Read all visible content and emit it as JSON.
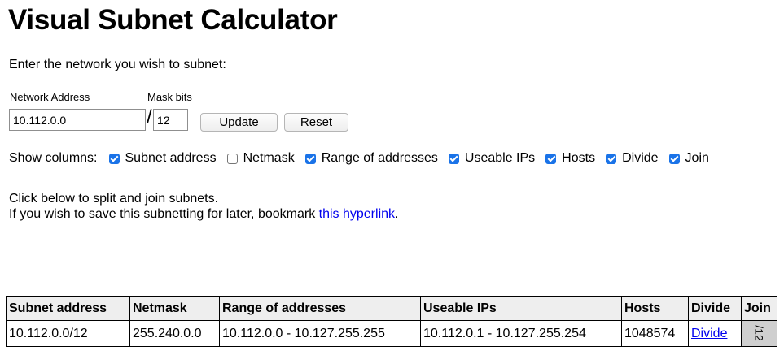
{
  "page": {
    "title": "Visual Subnet Calculator",
    "intro": "Enter the network you wish to subnet:"
  },
  "form": {
    "network_label": "Network Address",
    "network_value": "10.112.0.0",
    "mask_label": "Mask bits",
    "slash": "/",
    "mask_value": "12",
    "update_label": "Update",
    "reset_label": "Reset"
  },
  "columns": {
    "label": "Show columns:",
    "options": [
      {
        "label": "Subnet address",
        "checked": true
      },
      {
        "label": "Netmask",
        "checked": false
      },
      {
        "label": "Range of addresses",
        "checked": true
      },
      {
        "label": "Useable IPs",
        "checked": true
      },
      {
        "label": "Hosts",
        "checked": true
      },
      {
        "label": "Divide",
        "checked": true
      },
      {
        "label": "Join",
        "checked": true
      }
    ]
  },
  "help": {
    "line1": "Click below to split and join subnets.",
    "line2_prefix": "If you wish to save this subnetting for later, bookmark ",
    "link_text": "this hyperlink",
    "line2_suffix": "."
  },
  "table": {
    "headers": [
      "Subnet address",
      "Netmask",
      "Range of addresses",
      "Useable IPs",
      "Hosts",
      "Divide",
      "Join"
    ],
    "rows": [
      {
        "subnet": "10.112.0.0/12",
        "netmask": "255.240.0.0",
        "range": "10.112.0.0 - 10.127.255.255",
        "useable": "10.112.0.1 - 10.127.255.254",
        "hosts": "1048574",
        "divide": "Divide",
        "join": "/12"
      }
    ]
  },
  "colors": {
    "checkbox_accent": "#1a73e8",
    "link": "#0000ee",
    "header_bg": "#eeeeee",
    "join_bg": "#cfcfcf"
  }
}
